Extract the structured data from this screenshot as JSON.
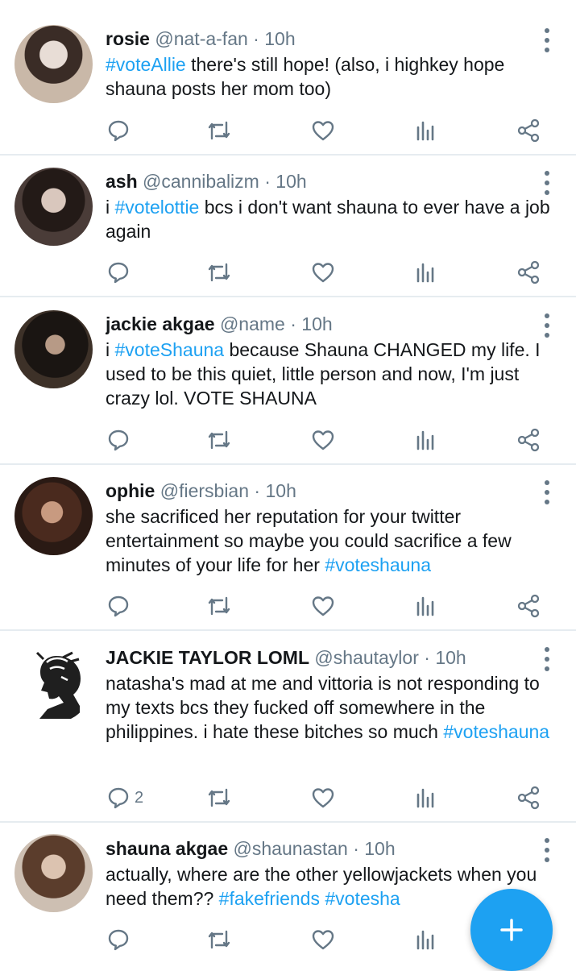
{
  "colors": {
    "accent": "#1da1f2",
    "muted": "#657786",
    "text": "#14171a",
    "divider": "#e6ecf0"
  },
  "icons": {
    "reply": "reply-icon",
    "retweet": "retweet-icon",
    "like": "heart-icon",
    "views": "analytics-icon",
    "share": "share-icon",
    "more": "more-vertical-icon",
    "compose": "plus-icon"
  },
  "tweets": [
    {
      "name": "rosie",
      "handle": "@nat-a-fan",
      "time": "10h",
      "parts": [
        {
          "t": "#voteAllie",
          "tag": true
        },
        {
          "t": " there's still hope! (also, i highkey hope shauna posts her mom too)",
          "tag": false
        }
      ],
      "reply_count": ""
    },
    {
      "name": "ash",
      "handle": "@cannibalizm",
      "time": "10h",
      "parts": [
        {
          "t": "i ",
          "tag": false
        },
        {
          "t": "#votelottie",
          "tag": true
        },
        {
          "t": " bcs i don't want shauna to ever have a job again",
          "tag": false
        }
      ],
      "reply_count": ""
    },
    {
      "name": "jackie akgae",
      "handle": "@name",
      "time": "10h",
      "parts": [
        {
          "t": "i ",
          "tag": false
        },
        {
          "t": "#voteShauna",
          "tag": true
        },
        {
          "t": " because Shauna CHANGED my life. I used to be this quiet, little person and now, I'm just crazy lol. VOTE SHAUNA",
          "tag": false
        }
      ],
      "reply_count": ""
    },
    {
      "name": "ophie",
      "handle": "@fiersbian",
      "time": "10h",
      "parts": [
        {
          "t": "she sacrificed her reputation for your twitter entertainment so maybe you could sacrifice a few minutes of your life for her ",
          "tag": false
        },
        {
          "t": "#voteshauna",
          "tag": true
        }
      ],
      "reply_count": ""
    },
    {
      "name": "JACKIE TAYLOR LOML",
      "handle": "@shautaylor",
      "time": "10h",
      "parts": [
        {
          "t": "natasha's mad at me and vittoria is not responding to my texts bcs they fucked off somewhere in the philippines. i hate these bitches so much ",
          "tag": false
        },
        {
          "t": "#voteshauna",
          "tag": true
        }
      ],
      "reply_count": "2"
    },
    {
      "name": "shauna akgae",
      "handle": "@shaunastan",
      "time": "10h",
      "parts": [
        {
          "t": "actually, where are the other yellowjackets when you need them?? ",
          "tag": false
        },
        {
          "t": "#fakefriends",
          "tag": true
        },
        {
          "t": " ",
          "tag": false
        },
        {
          "t": "#votesha",
          "tag": true
        }
      ],
      "reply_count": ""
    }
  ]
}
